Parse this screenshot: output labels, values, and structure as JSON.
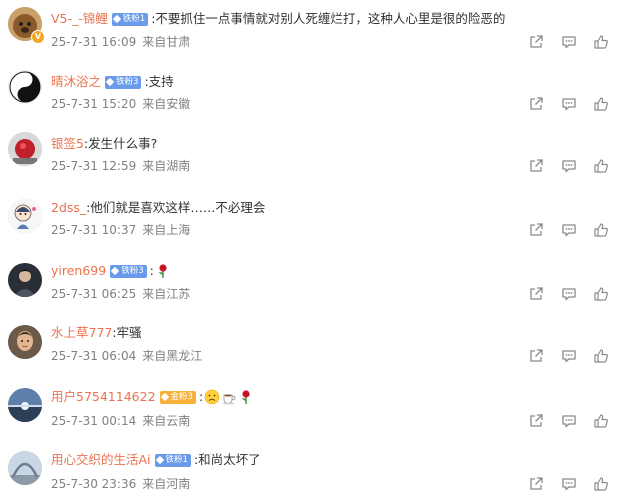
{
  "comments": [
    {
      "username": "V5-_-锦鲤",
      "badge": "铁粉1",
      "text": ":不要抓住一点事情就对别人死缠烂打，这种人心里是很的险恶的",
      "time": "25-7-31 16:09",
      "location": "来自甘肃",
      "verified_mark": "V",
      "avatar": "dog-photo"
    },
    {
      "username": "晴沐浴之",
      "badge": "铁粉3",
      "text": ":支持",
      "time": "25-7-31 15:20",
      "location": "来自安徽",
      "avatar": "yin-yang"
    },
    {
      "username": "银签5",
      "text": ":发生什么事?",
      "time": "25-7-31 12:59",
      "location": "来自湖南",
      "avatar": "red-object-photo"
    },
    {
      "username": "2dss_",
      "text": ":他们就是喜欢这样……不必理会",
      "time": "25-7-31 10:37",
      "location": "来自上海",
      "avatar": "cartoon-figure"
    },
    {
      "username": "yiren699",
      "badge": "铁粉3",
      "text": ":",
      "emojis": [
        "rose"
      ],
      "time": "25-7-31 06:25",
      "location": "来自江苏",
      "avatar": "person-photo"
    },
    {
      "username": "水上草777",
      "text": ":牢骚",
      "time": "25-7-31 06:04",
      "location": "来自黑龙江",
      "avatar": "man-portrait"
    },
    {
      "username": "用户5754114622",
      "badge": "金粉3",
      "badge_color": "#f7b13a",
      "text": ":",
      "emojis": [
        "sad-face",
        "coffee",
        "rose"
      ],
      "time": "25-7-31 00:14",
      "location": "来自云南",
      "avatar": "sky-sunset"
    },
    {
      "username": "用心交织的生活Ai",
      "badge": "铁粉1",
      "text": ":和尚太坏了",
      "time": "25-7-30 23:36",
      "location": "来自河南",
      "avatar": "arch-landscape"
    }
  ],
  "actions": {
    "share_icon": "share-icon",
    "reply_icon": "comment-icon",
    "like_icon": "thumbs-up-icon"
  },
  "colors": {
    "username": "#eb7350",
    "text": "#333333",
    "meta": "#808080",
    "fan_badge": "#6a9bea",
    "gold_badge": "#f7b13a",
    "icon": "#8a8a8a"
  }
}
